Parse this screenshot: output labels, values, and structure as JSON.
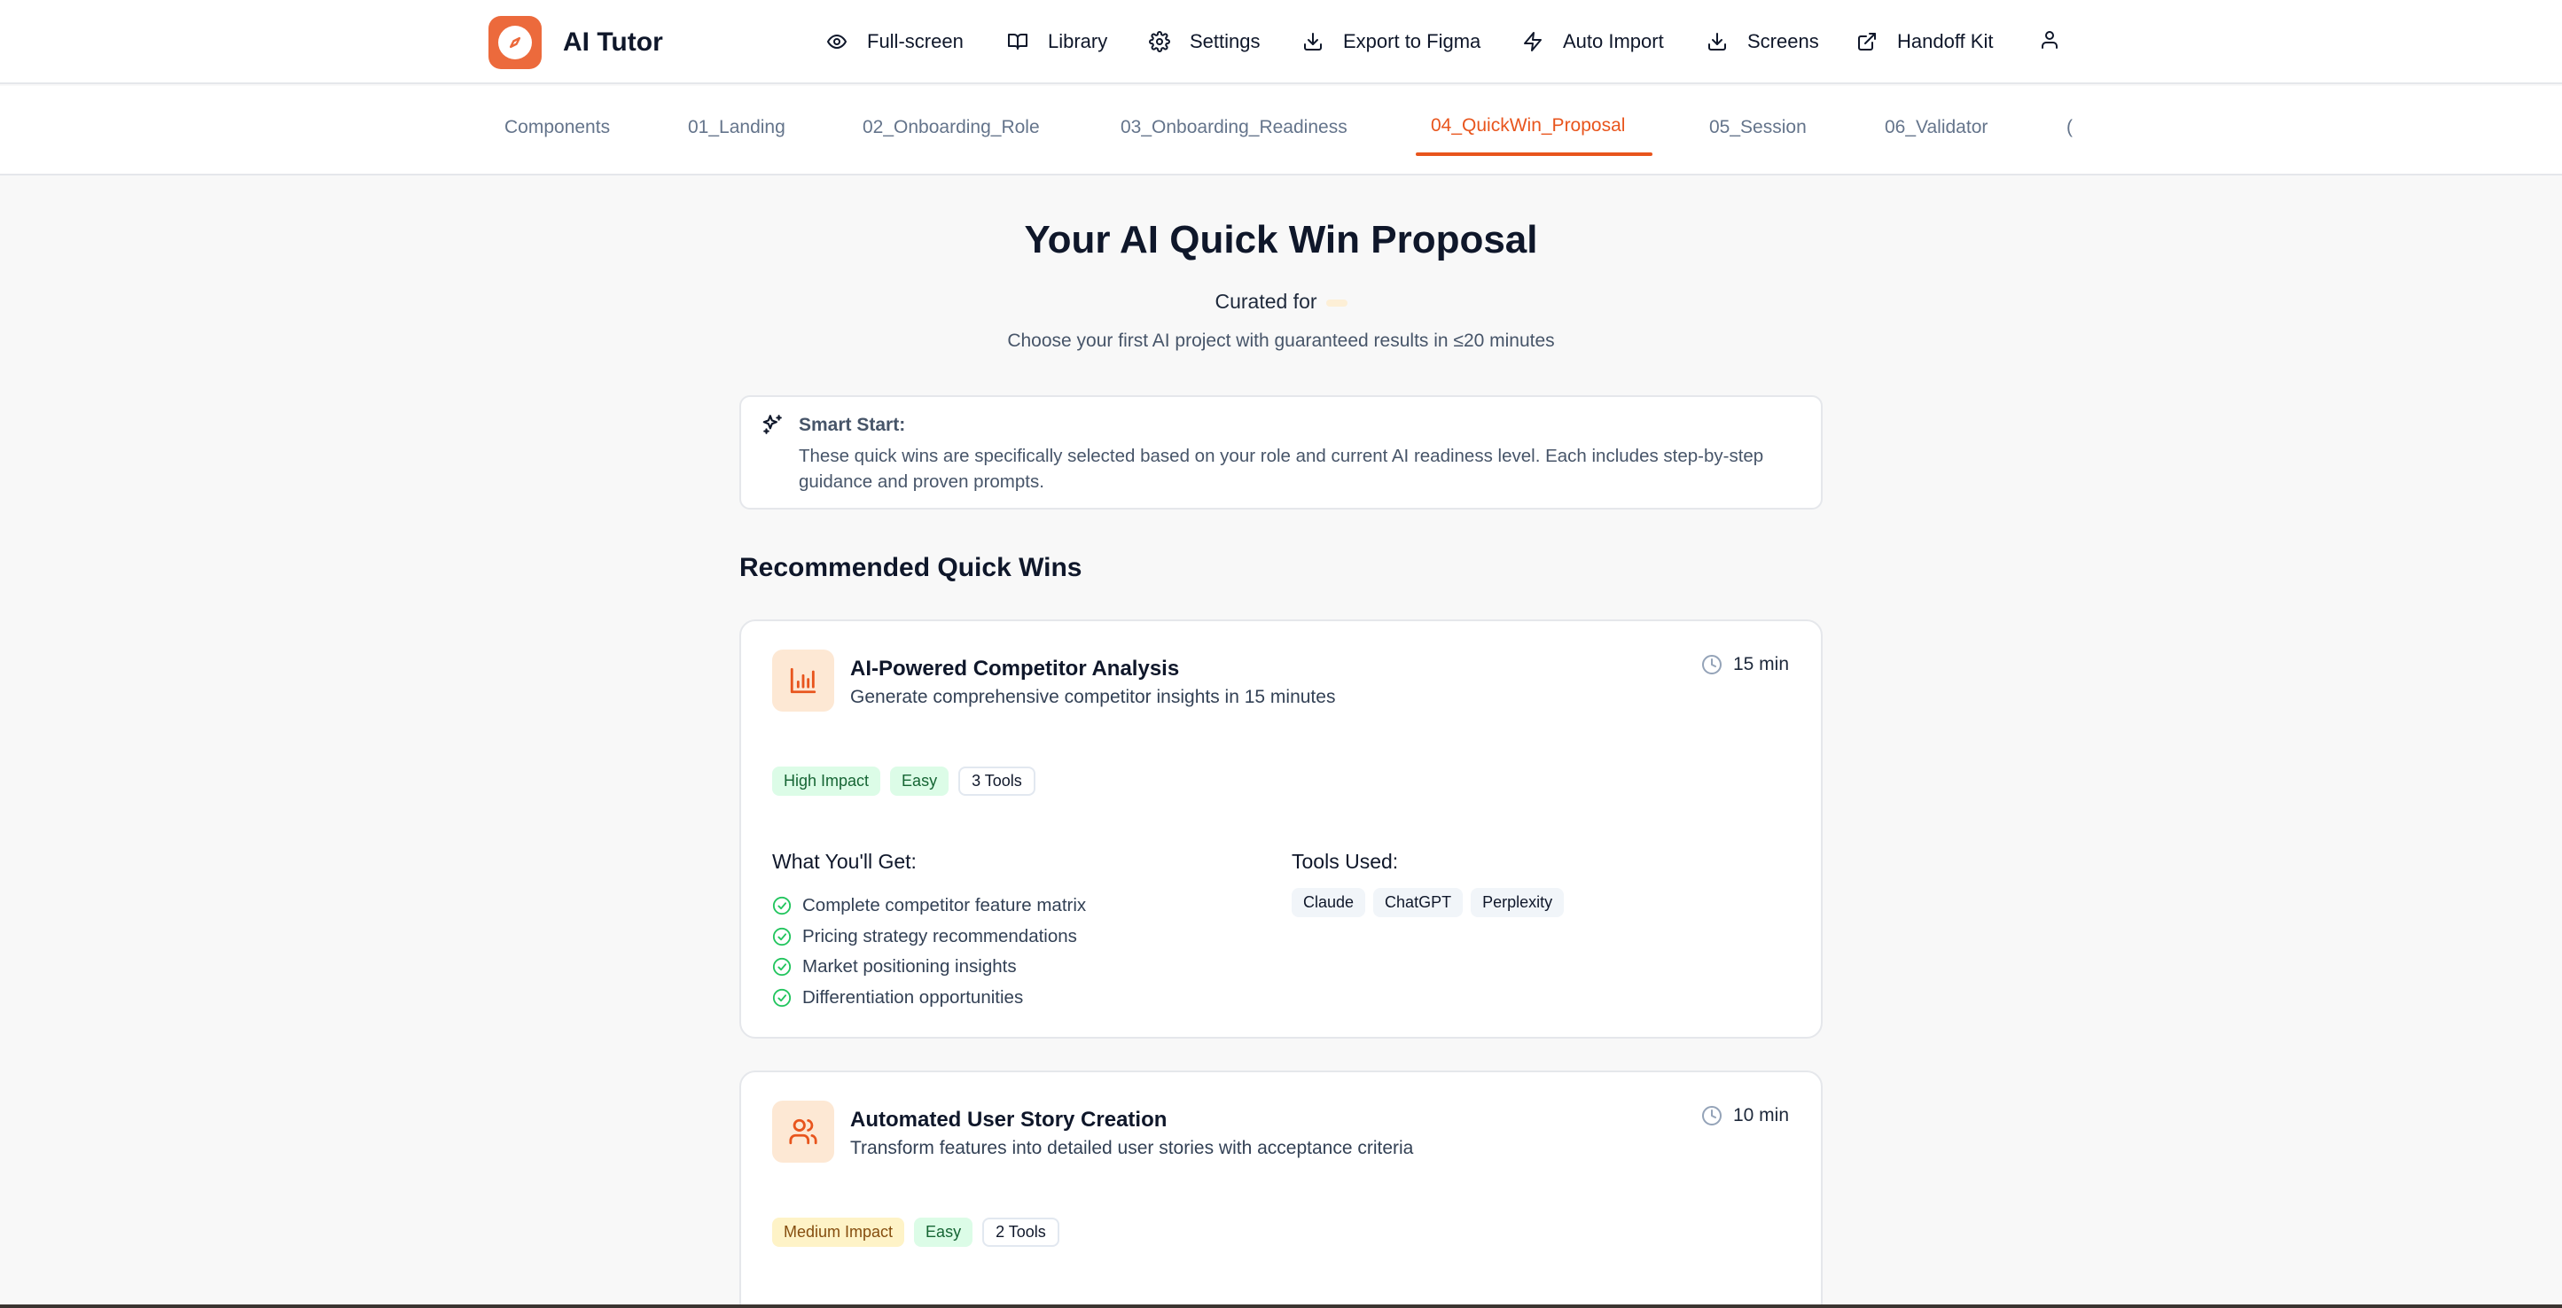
{
  "app": {
    "name": "AI Tutor"
  },
  "nav": {
    "items": [
      {
        "label": "Full-screen",
        "icon": "eye-icon"
      },
      {
        "label": "Library",
        "icon": "book-icon"
      },
      {
        "label": "Settings",
        "icon": "gear-icon"
      },
      {
        "label": "Export to Figma",
        "icon": "download-icon"
      },
      {
        "label": "Auto Import",
        "icon": "lightning-icon"
      },
      {
        "label": "Screens",
        "icon": "download-icon"
      },
      {
        "label": "Handoff Kit",
        "icon": "external-link-icon"
      }
    ],
    "user_icon": "user-icon"
  },
  "tabs": {
    "items": [
      "Components",
      "01_Landing",
      "02_Onboarding_Role",
      "03_Onboarding_Readiness",
      "04_QuickWin_Proposal",
      "05_Session",
      "06_Validator",
      "("
    ],
    "active": "04_QuickWin_Proposal"
  },
  "page": {
    "title": "Your AI Quick Win Proposal",
    "curated_for": "Curated for",
    "subtitle": "Choose your first AI project with guaranteed results in ≤20 minutes"
  },
  "smart_start": {
    "title": "Smart Start:",
    "text": "These quick wins are specifically selected based on your role and current AI readiness level. Each includes step-by-step guidance and proven prompts."
  },
  "section": {
    "title": "Recommended Quick Wins"
  },
  "cards": [
    {
      "icon": "bar-chart-icon",
      "title": "AI-Powered Competitor Analysis",
      "description": "Generate comprehensive competitor insights in 15 minutes",
      "time": "15 min",
      "badges": [
        "High Impact",
        "Easy",
        "3 Tools"
      ],
      "benefits_title": "What You'll Get:",
      "benefits": [
        "Complete competitor feature matrix",
        "Pricing strategy recommendations",
        "Market positioning insights",
        "Differentiation opportunities"
      ],
      "tools_title": "Tools Used:",
      "tools": [
        "Claude",
        "ChatGPT",
        "Perplexity"
      ]
    },
    {
      "icon": "users-icon",
      "title": "Automated User Story Creation",
      "description": "Transform features into detailed user stories with acceptance criteria",
      "time": "10 min",
      "badges": [
        "Medium Impact",
        "Easy",
        "2 Tools"
      ]
    }
  ],
  "colors": {
    "accent": "#e8551d",
    "logo": "#ec6a3c",
    "success": "#22c55e",
    "icon_bg": "#fde8d4"
  }
}
